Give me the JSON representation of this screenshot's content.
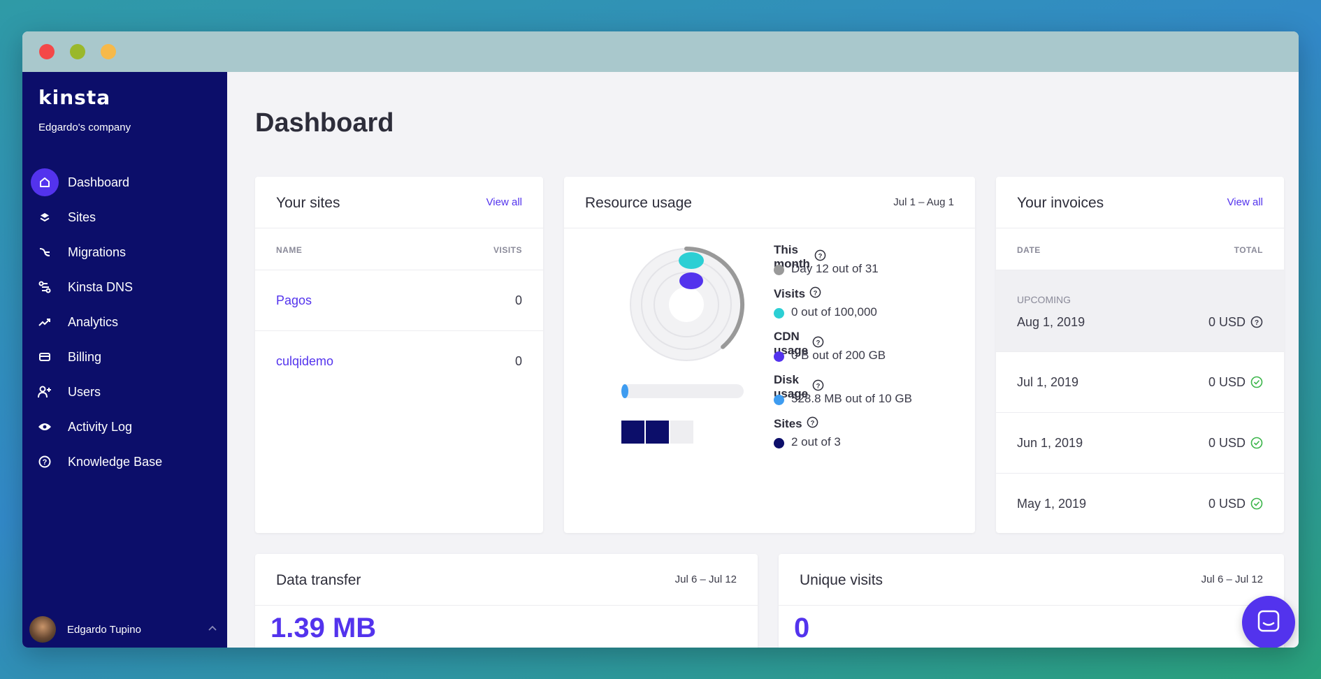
{
  "app": {
    "logo": "KINSTA",
    "company": "Edgardo's company"
  },
  "sidebar": {
    "items": [
      {
        "label": "Dashboard",
        "icon": "home-icon",
        "active": true
      },
      {
        "label": "Sites",
        "icon": "layers-icon"
      },
      {
        "label": "Migrations",
        "icon": "migrations-icon"
      },
      {
        "label": "Kinsta DNS",
        "icon": "dns-icon"
      },
      {
        "label": "Analytics",
        "icon": "trending-up-icon"
      },
      {
        "label": "Billing",
        "icon": "credit-card-icon"
      },
      {
        "label": "Users",
        "icon": "user-add-icon"
      },
      {
        "label": "Activity Log",
        "icon": "eye-icon"
      },
      {
        "label": "Knowledge Base",
        "icon": "help-circle-icon"
      }
    ],
    "user": {
      "name": "Edgardo Tupino"
    }
  },
  "page": {
    "title": "Dashboard"
  },
  "sites_card": {
    "title": "Your sites",
    "view_all": "View all",
    "col_name": "NAME",
    "col_visits": "VISITS",
    "rows": [
      {
        "name": "Pagos",
        "visits": "0"
      },
      {
        "name": "culqidemo",
        "visits": "0"
      }
    ]
  },
  "resource_card": {
    "title": "Resource usage",
    "range": "Jul 1 – Aug 1",
    "legend": [
      {
        "label": "This month",
        "value": "Day 12 out of 31",
        "color": "#999999",
        "fraction": 0.387
      },
      {
        "label": "Visits",
        "value": "0 out of 100,000",
        "color": "#2ccfd4",
        "fraction": 0
      },
      {
        "label": "CDN usage",
        "value": "0 B out of 200 GB",
        "color": "#5333ed",
        "fraction": 0
      },
      {
        "label": "Disk usage",
        "value": "528.8 MB out of 10 GB",
        "color": "#3e9cf0",
        "fraction": 0.053
      },
      {
        "label": "Sites",
        "value": "2 out of 3",
        "color": "#0c0e6a",
        "fraction": 0.667
      }
    ]
  },
  "invoices_card": {
    "title": "Your invoices",
    "view_all": "View all",
    "col_date": "DATE",
    "col_total": "TOTAL",
    "upcoming_label": "UPCOMING",
    "rows": [
      {
        "date": "Aug 1, 2019",
        "total": "0 USD",
        "status": "help-circle-icon",
        "upcoming": true
      },
      {
        "date": "Jul 1, 2019",
        "total": "0 USD",
        "status": "check-circle-icon"
      },
      {
        "date": "Jun 1, 2019",
        "total": "0 USD",
        "status": "check-circle-icon"
      },
      {
        "date": "May 1, 2019",
        "total": "0 USD",
        "status": "check-circle-icon"
      }
    ]
  },
  "transfer_card": {
    "title": "Data transfer",
    "range": "Jul 6 – Jul 12",
    "value": "1.39 MB"
  },
  "visits_card": {
    "title": "Unique visits",
    "range": "Jul 6 – Jul 12",
    "value": "0"
  },
  "colors": {
    "sidebar": "#0c0e6a",
    "accent": "#5333ed",
    "success": "#3bb54a"
  }
}
